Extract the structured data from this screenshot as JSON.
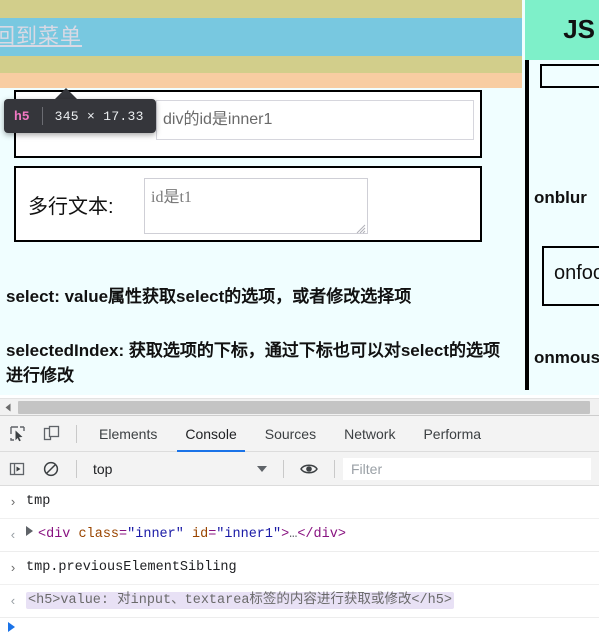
{
  "page": {
    "nav_link": "回到菜单",
    "block_one": {
      "heading_text": "div的id是inner1",
      "input_placeholder": "div的id是inner1",
      "input_value": ""
    },
    "block_two": {
      "label": "多行文本:",
      "textarea_placeholder": "id是t1",
      "textarea_value": ""
    },
    "paragraphs": [
      "select: value属性获取select的选项，或者修改选择项",
      "selectedIndex: 获取选项的下标，通过下标也可以对select的选项进行修改"
    ],
    "right_column": {
      "title": "JS",
      "box_top_text": "",
      "label_onblur": "onblur",
      "box_mid_text": "onfocus",
      "label_onmouse": "onmouseover"
    }
  },
  "inspector_tooltip": {
    "tag": "h5",
    "dimensions": "345 × 17.33"
  },
  "devtools": {
    "icons": {
      "inspect": "inspect-element-icon",
      "device": "device-toolbar-icon",
      "sidebar": "console-sidebar-icon",
      "clear": "clear-console-icon",
      "eye": "live-expression-icon"
    },
    "tabs": [
      {
        "label": "Elements",
        "active": false
      },
      {
        "label": "Console",
        "active": true
      },
      {
        "label": "Sources",
        "active": false
      },
      {
        "label": "Network",
        "active": false
      },
      {
        "label": "Performa",
        "active": false
      }
    ],
    "context_selector": "top",
    "filter_placeholder": "Filter",
    "filter_value": "",
    "console_rows": [
      {
        "kind": "input",
        "gutter": "›",
        "text": "tmp"
      },
      {
        "kind": "output-node",
        "gutter": "‹",
        "tag_open_lt": "<",
        "tag_name": "div",
        "attr1_name": "class",
        "attr1_value": "\"inner\"",
        "attr2_name": "id",
        "attr2_value": "\"inner1\"",
        "tag_open_gt": ">",
        "ellipsis": "…",
        "tag_close": "</div>"
      },
      {
        "kind": "input",
        "gutter": "›",
        "text": "tmp.previousElementSibling"
      },
      {
        "kind": "output-html",
        "gutter": "‹",
        "text": "<h5>value: 对input、textarea标签的内容进行获取或修改</h5>"
      }
    ]
  },
  "colors": {
    "band_khaki": "#d2ce8b",
    "band_blue": "#78c8e0",
    "band_peach": "#f8cda2",
    "mint": "#7ef0c9",
    "page_bg": "#f0feff",
    "tooltip_bg": "#35363b",
    "tooltip_tag": "#f178c3",
    "tab_accent": "#1a73e8"
  }
}
